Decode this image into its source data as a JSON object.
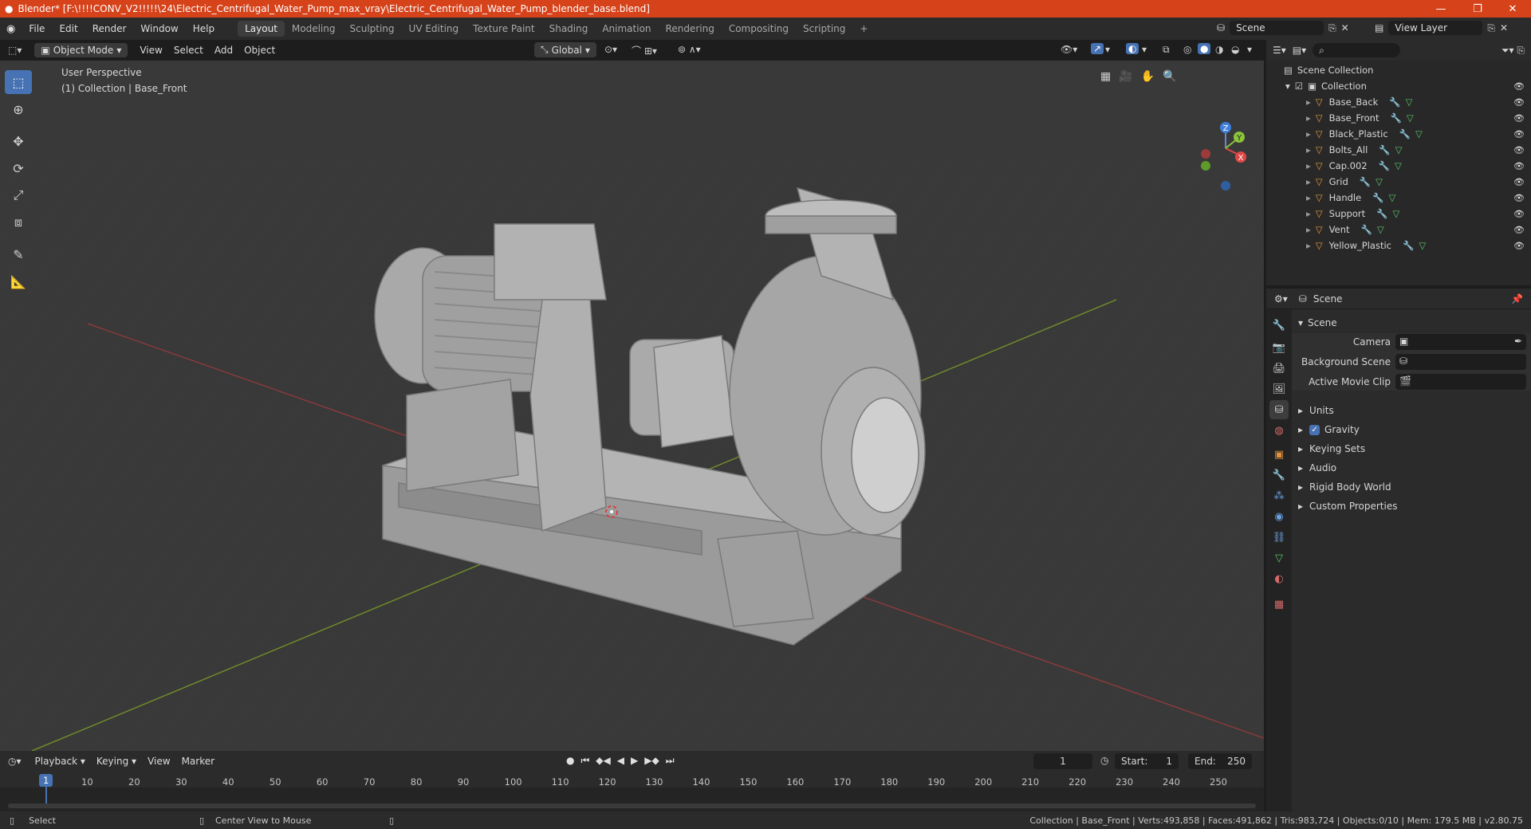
{
  "titlebar": {
    "title": "Blender* [F:\\!!!!CONV_V2!!!!!\\24\\Electric_Centrifugal_Water_Pump_max_vray\\Electric_Centrifugal_Water_Pump_blender_base.blend]",
    "accent": "#d6421a"
  },
  "menu": [
    "File",
    "Edit",
    "Render",
    "Window",
    "Help"
  ],
  "workspaces": [
    "Layout",
    "Modeling",
    "Sculpting",
    "UV Editing",
    "Texture Paint",
    "Shading",
    "Animation",
    "Rendering",
    "Compositing",
    "Scripting"
  ],
  "workspace_active": "Layout",
  "scene_selector": "Scene",
  "view_layer": "View Layer",
  "viewport_header": {
    "mode": "Object Mode",
    "menus": [
      "View",
      "Select",
      "Add",
      "Object"
    ],
    "transform_orientation": "Global"
  },
  "viewport": {
    "perspective": "User Perspective",
    "collection_info": "(1) Collection | Base_Front",
    "gizmo_axes": [
      "Z",
      "Y",
      "X"
    ]
  },
  "tools": [
    "select-box",
    "cursor",
    "move",
    "rotate",
    "scale",
    "transform",
    "annotate",
    "measure"
  ],
  "outliner": {
    "root": "Scene Collection",
    "collection": "Collection",
    "objects": [
      "Base_Back",
      "Base_Front",
      "Black_Plastic",
      "Bolts_All",
      "Cap.002",
      "Grid",
      "Handle",
      "Support",
      "Vent",
      "Yellow_Plastic"
    ]
  },
  "properties": {
    "context_label": "Scene",
    "panel_title": "Scene",
    "camera_label": "Camera",
    "background_scene_label": "Background Scene",
    "active_movie_clip_label": "Active Movie Clip",
    "sections": [
      "Units",
      "Gravity",
      "Keying Sets",
      "Audio",
      "Rigid Body World",
      "Custom Properties"
    ],
    "gravity_checked": true
  },
  "timeline": {
    "menus": [
      "Playback",
      "Keying",
      "View",
      "Marker"
    ],
    "current_frame": "1",
    "start_label": "Start:",
    "start": "1",
    "end_label": "End:",
    "end": "250",
    "ticks": [
      "1",
      "10",
      "20",
      "30",
      "40",
      "50",
      "60",
      "70",
      "80",
      "90",
      "100",
      "110",
      "120",
      "130",
      "140",
      "150",
      "160",
      "170",
      "180",
      "190",
      "200",
      "210",
      "220",
      "230",
      "240",
      "250"
    ]
  },
  "status": {
    "left": "Select",
    "middle": "Center View to Mouse",
    "right": "Collection | Base_Front | Verts:493,858 | Faces:491,862 | Tris:983,724 | Objects:0/10 | Mem: 179.5 MB | v2.80.75"
  }
}
